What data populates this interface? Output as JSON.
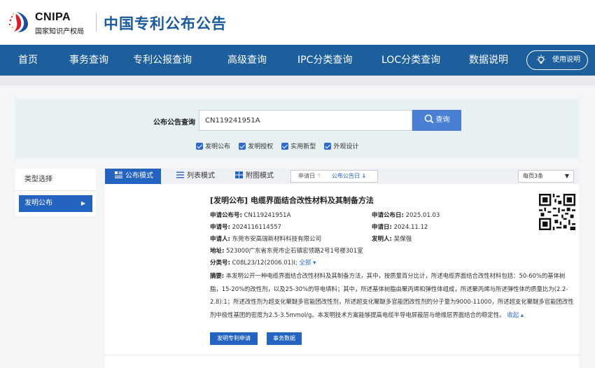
{
  "header": {
    "logo_en": "CNIPA",
    "logo_cn": "国家知识产权局",
    "site_title": "中国专利公布公告"
  },
  "nav": {
    "items": [
      "首页",
      "事务查询",
      "专利公报查询",
      "高级查询",
      "IPC分类查询",
      "LOC分类查询",
      "数据说明"
    ],
    "help": "使用说明"
  },
  "search": {
    "label": "公布公告查询",
    "value": "CN119241951A",
    "button": "查询",
    "checkboxes": [
      "发明公布",
      "发明授权",
      "实用新型",
      "外观设计"
    ]
  },
  "sidebar": {
    "heading": "类型选择",
    "item": "发明公布"
  },
  "toolbar": {
    "views": [
      "公布模式",
      "列表模式",
      "附图模式"
    ],
    "sort_apply_date": "申请日",
    "sort_pub_date": "公布公告日",
    "per_page": "每页3条"
  },
  "result": {
    "title": "[发明公布] 电缆界面结合改性材料及其制备方法",
    "pub_no_label": "申请公布号:",
    "pub_no": "CN119241951A",
    "pub_date_label": "申请公布日:",
    "pub_date": "2025.01.03",
    "app_no_label": "申请号:",
    "app_no": "2024116114557",
    "app_date_label": "申请日:",
    "app_date": "2024.11.12",
    "applicant_label": "申请人:",
    "applicant": "东莞市安高瑞新材料科技有限公司",
    "inventor_label": "发明人:",
    "inventor": "吴保强",
    "address_label": "地址:",
    "address": "523000广东省东莞市企石镇宏领路2号1号楼301室",
    "class_label": "分类号:",
    "class": "C08L23/12(2006.01)I;",
    "class_all": "全部 ▾",
    "abstract_label": "摘要:",
    "abstract": "本发明公开一种电缆界面结合改性材料及其制备方法，其中，按质量百分比计，所述电缆界面结合改性材料包括：50-60%的基体树脂，15-20%的改性剂，以及25-30%的导电填料；其中，所述基体树脂由聚丙烯和弹性体组成，所述聚丙烯与所述弹性体的质量比为(2.2-2.8):1；所述改性剂为超支化聚醚多官能团改性剂，所述超支化聚醚多官能团改性剂的分子量为9000-11000，所述超支化聚醚多官能团改性剂中极性基团的密度为2.5-3.5mmol/g。本发明技术方案能够提高电缆半导电屏蔽层与绝缘层界面结合的稳定性。",
    "collapse": "收起 ▴",
    "btn_apply": "发明专利申请",
    "btn_affairs": "事务数据"
  },
  "colors": {
    "nav_blue": "#1d5f9d",
    "accent_blue": "#2463bf",
    "search_panel": "#e7f1f2"
  }
}
